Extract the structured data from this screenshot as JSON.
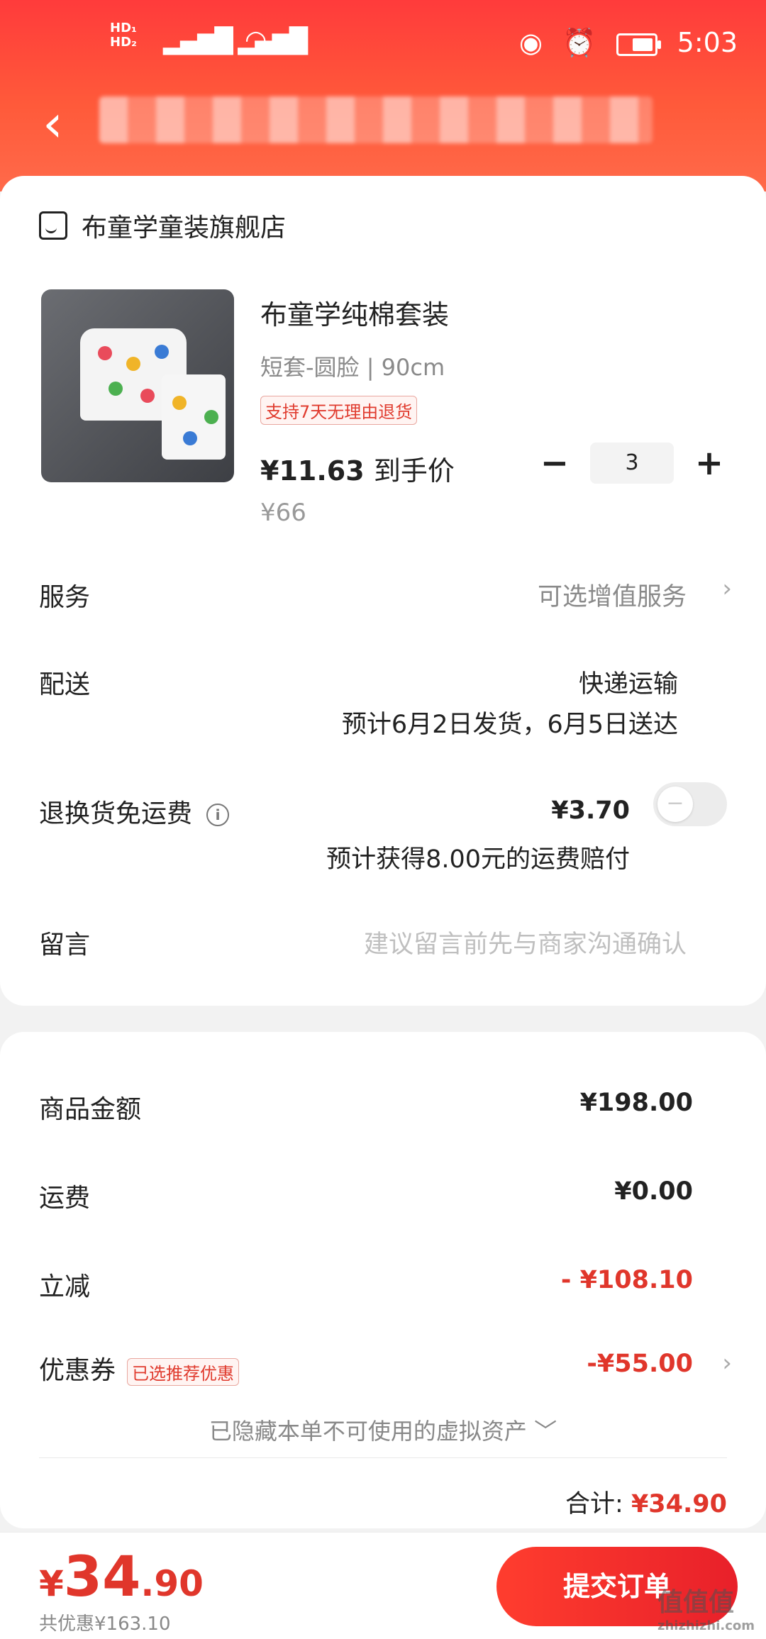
{
  "status": {
    "left": "HD₁ HD₂ 4G 4G",
    "time": "5:03"
  },
  "shop": {
    "name": "布童学童装旗舰店"
  },
  "product": {
    "title": "布童学纯棉套装",
    "spec": "短套-圆脸 | 90cm",
    "badge": "支持7天无理由退货",
    "price": "¥11.63",
    "price_tag": "到手价",
    "original_price": "¥66",
    "quantity": "3"
  },
  "rows": {
    "service_label": "服务",
    "service_value": "可选增值服务",
    "delivery_label": "配送",
    "delivery_method": "快递运输",
    "delivery_eta": "预计6月2日发货，6月5日送达",
    "return_label": "退换货免运费",
    "return_price": "¥3.70",
    "return_note": "预计获得8.00元的运费赔付",
    "message_label": "留言",
    "message_placeholder": "建议留言前先与商家沟通确认"
  },
  "summary": {
    "goods_label": "商品金额",
    "goods_value": "¥198.00",
    "shipping_label": "运费",
    "shipping_value": "¥0.00",
    "discount_label": "立减",
    "discount_value": "- ¥108.10",
    "coupon_label": "优惠券",
    "coupon_badge": "已选推荐优惠",
    "coupon_value": "-¥55.00",
    "hidden_note": "已隐藏本单不可使用的虚拟资产",
    "total_label": "合计:",
    "total_value": "¥34.90"
  },
  "footer": {
    "currency": "¥",
    "price_int": "34",
    "price_dec": ".90",
    "saved": "共优惠¥163.10",
    "submit": "提交订单"
  },
  "watermark": {
    "main": "值值值",
    "sub": "zhizhizhi.com"
  }
}
